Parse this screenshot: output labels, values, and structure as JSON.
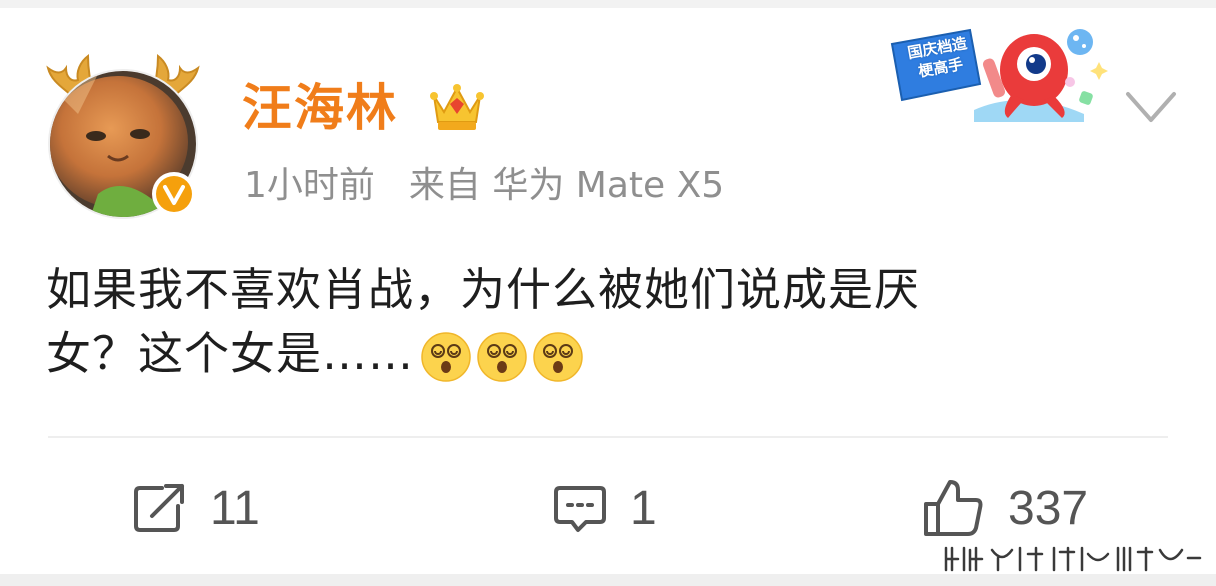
{
  "post": {
    "user_name": "汪海林",
    "time": "1小时前",
    "source": "来自 华为 Mate X5",
    "badge_text": "国庆档造梗高手",
    "body_line1": "如果我不喜欢肖战，为什么被她们说成是厌",
    "body_line2": "女？这个女是……",
    "emoji_icons": [
      "dizzy-face-icon",
      "dizzy-face-icon",
      "dizzy-face-icon"
    ]
  },
  "actions": {
    "repost_count": "11",
    "comment_count": "1",
    "like_count": "337"
  },
  "colors": {
    "username": "#f07d1a",
    "verified_badge": "#f5a00c",
    "meta_text": "#8f8f8f",
    "body_text": "#1e1e1e",
    "action_icon": "#555555"
  }
}
